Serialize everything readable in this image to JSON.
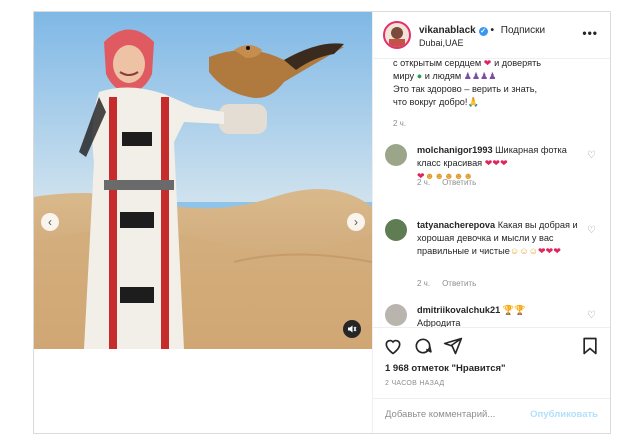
{
  "post": {
    "username": "vikanablack",
    "follow_label": "Подписки",
    "location": "Dubai,UAE",
    "more_label": "•••"
  },
  "caption": {
    "line1": "с открытым сердцем",
    "line1b": "и доверять",
    "line2": "миру",
    "line2b": "и людям",
    "line3": "Это так здорово – верить и знать,",
    "line4": "что вокруг добро!",
    "time": "2 ч."
  },
  "comments": [
    {
      "username": "molchanigor1993",
      "text": "Шикарная фотка класс красивая",
      "time": "2 ч.",
      "reply_label": "Ответить"
    },
    {
      "username": "tatyanacherepova",
      "text": "Какая вы добрая и хорошая девочка и мысли у вас правильные и чистые",
      "time": "2 ч.",
      "reply_label": "Ответить"
    },
    {
      "username": "dmitriikovalchuk21",
      "text": "Афродита",
      "time": "",
      "reply_label": ""
    }
  ],
  "actions": {
    "likes": "1 968 отметок \"Нравится\"",
    "posted_ago": "2 ЧАСОВ НАЗАД"
  },
  "add_comment": {
    "placeholder": "Добавьте комментарий...",
    "publish_label": "Опубликовать"
  },
  "colors": {
    "accent": "#3897f0",
    "heart": "#e0245e",
    "muted": "#8e8e8e",
    "border": "#dbdbdb"
  }
}
